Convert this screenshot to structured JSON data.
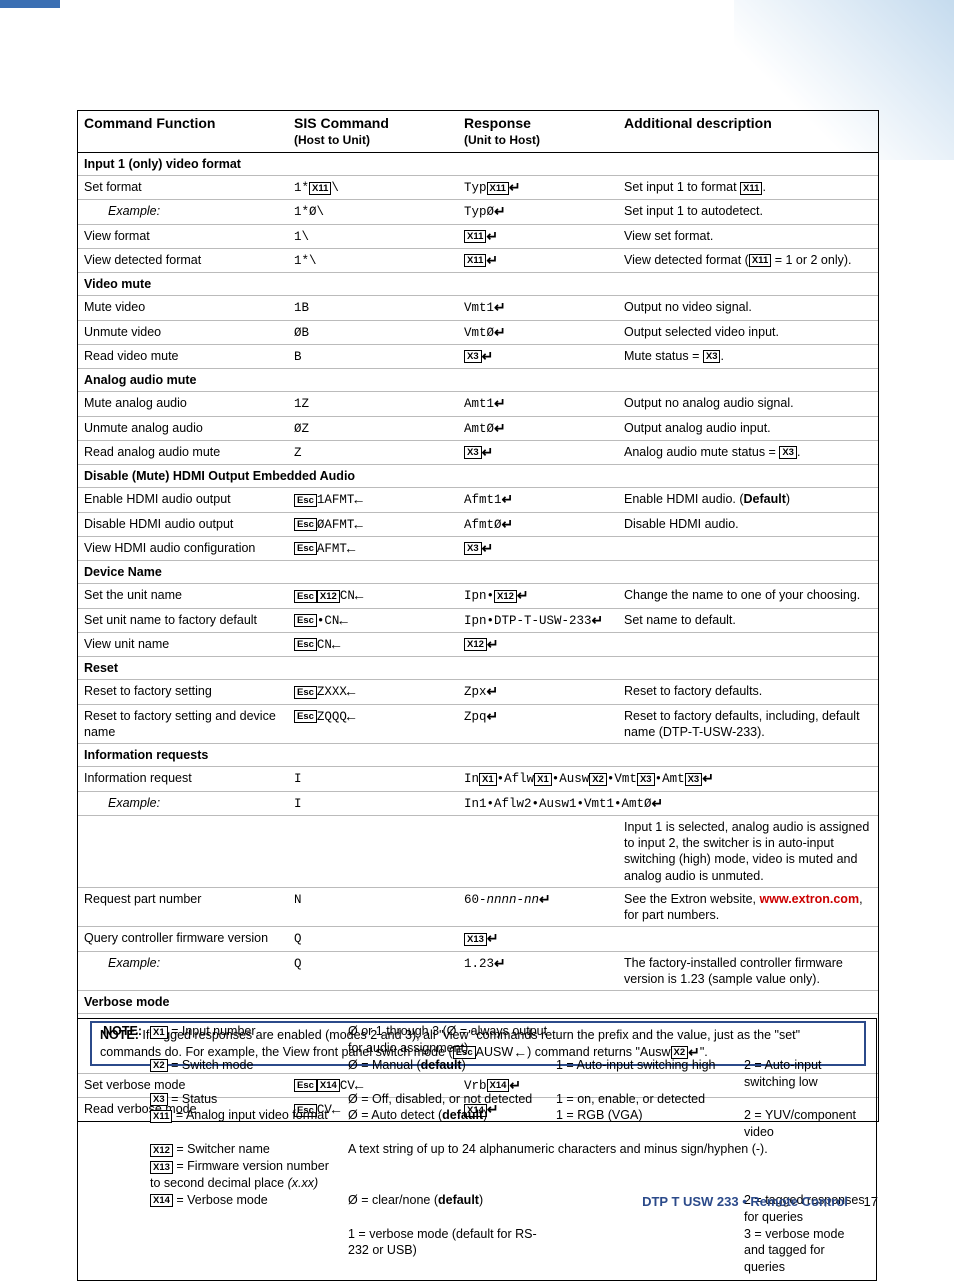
{
  "headers": {
    "col1": "Command Function",
    "col2": "SIS Command",
    "col2sub": "(Host to Unit)",
    "col3": "Response",
    "col3sub": "(Unit to Host)",
    "col4": "Additional description"
  },
  "sections": [
    {
      "title": "Input 1 (only) video format",
      "rows": [
        {
          "fn": "Set format",
          "cmd": [
            "1*",
            "[X11]",
            "\\"
          ],
          "resp": [
            "Typ",
            "[X11]",
            "↵"
          ],
          "desc": [
            "Set input 1 to format ",
            "[X11]",
            "."
          ]
        },
        {
          "fn_sub": "Example:",
          "cmd": [
            "1*Ø\\"
          ],
          "resp": [
            "TypØ",
            "↵"
          ],
          "desc": [
            "Set input 1 to autodetect."
          ]
        },
        {
          "fn": "View format",
          "cmd": [
            "1\\"
          ],
          "resp": [
            "[X11]",
            "↵"
          ],
          "desc": [
            "View set format."
          ]
        },
        {
          "fn": "View detected format",
          "cmd": [
            "1*\\"
          ],
          "resp": [
            "[X11]",
            "↵"
          ],
          "desc": [
            "View detected format (",
            "[X11]",
            " = 1 or 2 only)."
          ]
        }
      ]
    },
    {
      "title": "Video mute",
      "rows": [
        {
          "fn": "Mute video",
          "cmd": [
            "1B"
          ],
          "resp": [
            "Vmt1",
            "↵"
          ],
          "desc": [
            "Output no video signal."
          ]
        },
        {
          "fn": "Unmute video",
          "cmd": [
            "ØB"
          ],
          "resp": [
            "VmtØ",
            "↵"
          ],
          "desc": [
            "Output selected video input."
          ]
        },
        {
          "fn": "Read video mute",
          "cmd": [
            "B"
          ],
          "resp": [
            "[X3]",
            "↵"
          ],
          "desc": [
            "Mute status = ",
            "[X3]",
            "."
          ]
        }
      ]
    },
    {
      "title": "Analog audio mute",
      "rows": [
        {
          "fn": "Mute analog audio",
          "cmd": [
            "1Z"
          ],
          "resp": [
            "Amt1",
            "↵"
          ],
          "desc": [
            "Output no analog audio signal."
          ]
        },
        {
          "fn": "Unmute analog audio",
          "cmd": [
            "ØZ"
          ],
          "resp": [
            "AmtØ",
            "↵"
          ],
          "desc": [
            "Output analog audio input."
          ]
        },
        {
          "fn": "Read analog audio mute",
          "cmd": [
            "Z"
          ],
          "resp": [
            "[X3]",
            "↵"
          ],
          "desc": [
            "Analog audio mute status = ",
            "[X3]",
            "."
          ]
        }
      ]
    },
    {
      "title": "Disable (Mute) HDMI Output Embedded Audio",
      "rows": [
        {
          "fn": "Enable HDMI audio output",
          "cmd": [
            "[Esc]",
            "1AFMT",
            "←"
          ],
          "resp": [
            "Afmt1",
            "↵"
          ],
          "desc": [
            "Enable HDMI audio. (",
            "<b>Default</b>",
            ")"
          ]
        },
        {
          "fn": "Disable HDMI audio output",
          "cmd": [
            "[Esc]",
            "ØAFMT",
            "←"
          ],
          "resp": [
            "AfmtØ",
            "↵"
          ],
          "desc": [
            "Disable HDMI audio."
          ]
        },
        {
          "fn": "View HDMI audio configuration",
          "cmd": [
            "[Esc]",
            "AFMT",
            "←"
          ],
          "resp": [
            "[X3]",
            "↵"
          ],
          "desc": [
            ""
          ]
        }
      ]
    },
    {
      "title": "Device Name",
      "rows": [
        {
          "fn": "Set the unit name",
          "cmd": [
            "[Esc]",
            "[X12]",
            "CN",
            "←"
          ],
          "resp": [
            "Ipn•",
            "[X12]",
            "↵"
          ],
          "desc": [
            "Change the name to one of your choosing."
          ]
        },
        {
          "fn": "Set unit name to factory default",
          "cmd": [
            "[Esc]",
            "•CN",
            "←"
          ],
          "resp": [
            "Ipn•DTP-T-USW-233",
            "↵"
          ],
          "desc": [
            "Set name to default."
          ]
        },
        {
          "fn": "View unit name",
          "cmd": [
            "[Esc]",
            "CN",
            "←"
          ],
          "resp": [
            "[X12]",
            "↵"
          ],
          "desc": [
            ""
          ]
        }
      ]
    },
    {
      "title": "Reset",
      "rows": [
        {
          "fn": "Reset to factory setting",
          "cmd": [
            "[Esc]",
            "ZXXX",
            "←"
          ],
          "resp": [
            "Zpx",
            "↵"
          ],
          "desc": [
            "Reset to factory defaults."
          ]
        },
        {
          "fn": "Reset to factory setting and device name",
          "cmd": [
            "[Esc]",
            "ZQQQ",
            "←"
          ],
          "resp": [
            "Zpq",
            "↵"
          ],
          "desc": [
            "Reset to factory defaults, including, default name (DTP-T-USW-233)."
          ]
        }
      ]
    },
    {
      "title": "Information requests",
      "rows": [
        {
          "fn": "Information request",
          "cmd": [
            "I"
          ],
          "resp": [
            "In",
            "[X1]",
            "•Aflw",
            "[X1]",
            "•Ausw",
            "[X2]",
            "•Vmt",
            "[X3]",
            "•Amt",
            "[X3]",
            "↵"
          ],
          "desc": [
            ""
          ],
          "respspan": true
        },
        {
          "fn_sub": "Example:",
          "cmd": [
            "I"
          ],
          "resp": [
            "In1•Aflw2•Ausw1•Vmt1•AmtØ",
            "↵"
          ],
          "desc": [
            ""
          ],
          "respspan": true,
          "rawhtml_after": "Input 1 is selected, analog audio is assigned to input 2, the switcher is in auto-input switching (high) mode, video is muted and analog audio is unmuted."
        },
        {
          "fn": "Request part number",
          "cmd": [
            "N"
          ],
          "resp": [
            "60-<i>nnnn-nn</i>",
            "↵"
          ],
          "desc": [
            "See the Extron website, ",
            "<span class='redlink'>www.extron.com</span>",
            ", for part numbers."
          ]
        },
        {
          "fn": "Query controller firmware version",
          "cmd": [
            "Q"
          ],
          "resp": [
            "[X13]",
            "↵"
          ],
          "desc": [
            ""
          ]
        },
        {
          "fn_sub": "Example:",
          "cmd": [
            "Q"
          ],
          "resp": [
            "1.23",
            "↵"
          ],
          "desc": [
            "The factory-installed controller firmware version is 1.23 (sample value only)."
          ]
        }
      ]
    },
    {
      "title": "Verbose mode",
      "note": "If tagged responses are enabled (modes 2 and 3), all \"view\" commands return the prefix and the value, just as the \"set\" commands do. For example, the View front panel switch mode ([Esc]AUSW←) command returns \"Ausw[X2]↵\".",
      "rows": [
        {
          "fn": "Set verbose mode",
          "cmd": [
            "[Esc]",
            "[X14]",
            "CV",
            "←"
          ],
          "resp": [
            "Vrb",
            "[X14]",
            "↵"
          ],
          "desc": [
            ""
          ]
        },
        {
          "fn": "Read verbose mode",
          "cmd": [
            "[Esc]",
            "CV",
            "←"
          ],
          "resp": [
            "[X14]",
            "↵"
          ],
          "desc": [
            ""
          ],
          "last": true
        }
      ]
    }
  ],
  "footnote": {
    "label": "NOTE:",
    "lines": [
      {
        "left": [
          "[X1]",
          " = Input number"
        ],
        "mid": "Ø or 1 through 3 (Ø = always output for audio assignment)",
        "right": ""
      },
      {
        "left": [
          "[X2]",
          " = Switch mode"
        ],
        "mid": "Ø = Manual (<b>default</b>)",
        "r1": "1 = Auto-input switching high",
        "r2": "2 = Auto-input switching low"
      },
      {
        "left": [
          "[X3]",
          " = Status"
        ],
        "mid": "Ø = Off, disabled, or not detected",
        "r1": "1 = on, enable, or detected",
        "r2": ""
      },
      {
        "left": [
          "[X11]",
          " = Analog input video format"
        ],
        "mid": "Ø = Auto detect (<b>default</b>)",
        "r1": "1 = RGB (VGA)",
        "r2": "2 = YUV/component video"
      },
      {
        "left": [
          "[X12]",
          " = Switcher name"
        ],
        "mid": "A text string of up to 24 alphanumeric characters and minus sign/hyphen (-).",
        "span": true
      },
      {
        "left": [
          "[X13]",
          " = Firmware version number to second decimal place <i>(x.xx)</i>"
        ],
        "mid": "",
        "span": true
      },
      {
        "left": [
          "[X14]",
          " = Verbose mode"
        ],
        "mid": "Ø = clear/none (<b>default</b>)",
        "r1": "",
        "r2": "2 = tagged responses for queries"
      },
      {
        "left": [
          ""
        ],
        "mid": "1 = verbose mode (default for RS-232 or USB)",
        "r1": "",
        "r2": "3 = verbose mode and tagged for queries"
      }
    ]
  },
  "footer": {
    "title": "DTP T USW 233 • Remote Control",
    "page": "17"
  }
}
